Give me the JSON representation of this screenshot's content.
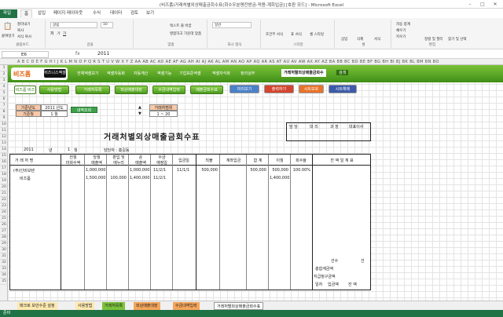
{
  "window": {
    "title": "(비즈폼)거래처별외상매출금회수표(회수우분명잔받금-적용-계회입금] [호환 모드] - Microsoft Excel"
  },
  "tabs": [
    "파일",
    "홈",
    "삽입",
    "페이지 레이아웃",
    "수식",
    "데이터",
    "검토",
    "보기"
  ],
  "ribbon": {
    "paste": "붙여넣기",
    "cut": "잘라내기",
    "copy": "복사",
    "format_copy": "서식 복사",
    "clipboard": "클립보드",
    "font_name": "굴림",
    "font_size": "10",
    "font_group": "글꼴",
    "align_group": "맞춤",
    "number_group": "표시 형식",
    "style_group": "스타일",
    "cells_group": "셀",
    "insert": "삽입",
    "delete": "삭제",
    "format": "서식",
    "edit_group": "편집",
    "autosum": "자동 합계",
    "fill": "채우기",
    "clear": "지우기",
    "sort": "정렬 및 필터",
    "find": "찾기 및 선택",
    "wrap": "텍스트 줄 바꿈",
    "merge": "병합하고 가운데 맞춤",
    "general": "일반",
    "cond": "조건부 서식",
    "table": "표 서식",
    "cellstyle": "셀 스타일"
  },
  "formula": {
    "cell": "E6",
    "value": "2011"
  },
  "columns_header": "A B C D E F G H I J K L M N O P Q R S T U V W X Y Z AA AB AC AD AE AF AG AH AI AJ AK AL AM AN AO AP AQ AR AS AT AU AV AW AX AY AZ BA BB BC BD BE BF BG BH BI BJ BK BL BM BN BO",
  "rows": [
    "1",
    "2",
    "3",
    "4",
    "5",
    "6",
    "7",
    "8",
    "9",
    "10",
    "11",
    "12",
    "13",
    "14",
    "15",
    "16",
    "17",
    "18",
    "19",
    "20",
    "21",
    "22",
    "23",
    "24",
    "25",
    "26",
    "27",
    "28",
    "29",
    "30",
    "31",
    "32",
    "33",
    "34",
    "35"
  ],
  "banner": {
    "logo": "비즈폼",
    "logo_sub": "비즈니스엑셀",
    "nav": [
      "전체엑셀보기",
      "엑셀자동화",
      "자동계산",
      "엑셀기능",
      "기업표준엑셀",
      "엑셀자식화",
      "정리실무"
    ],
    "selected": "거래처별외상매출금회수",
    "search": "검색"
  },
  "buttons": {
    "b1": "비즈폼 비즈",
    "b2": "사용방법",
    "b3": "거래처목록",
    "b4": "외상매출대장",
    "b5": "수금내역입력",
    "b6": "매출금회수표",
    "print_preview": "미리보기",
    "print": "출력하기",
    "sheet_protect": "시트보호",
    "sheet_unprotect": "시트해제",
    "search_detail": "내역조회"
  },
  "filter": {
    "year_label": "기준년도",
    "year": "2011 년도",
    "month_label": "기준월",
    "month": "1 월",
    "range_label": "거래처범위",
    "range": "1 ~ 20"
  },
  "doc": {
    "title": "거래처별외상매출금회수표",
    "year": "2011",
    "year_unit": "년",
    "month": "1",
    "month_unit": "월",
    "manager": "담당자 : 홍길동",
    "approval": [
      "담 당",
      "대 리",
      "과 장",
      "대표이사"
    ],
    "headers": [
      "거 래 처 명",
      "전월\n미회수액",
      "당월\n매출액",
      "판입 및\n에누리",
      "순\n매출액",
      "수금\n예정일",
      "입금일",
      "직불",
      "계좌입금",
      "합 계",
      "이월",
      "회수율",
      "잔 액 일 계 표"
    ],
    "rows": [
      [
        "(주)인비모텐",
        "",
        "1,000,000",
        "",
        "1,000,000",
        "11/2/1",
        "11/1/1",
        "500,000",
        "",
        "500,000",
        "500,000",
        "100.00%"
      ],
      [
        "비즈폼",
        "",
        "1,500,000",
        "100,000",
        "1,400,000",
        "11/2/1",
        "",
        "",
        "",
        "",
        "1,400,000",
        ""
      ]
    ],
    "summary": {
      "count": "건수",
      "count_unit": "건",
      "total_label": "총합계금액",
      "paid_label": "지급청구금액",
      "date": "일자",
      "deposit": "입금액",
      "balance": "잔 액"
    }
  },
  "sheettabs": [
    "매크로 보안수준 설정",
    "사용방법",
    "거래처목록",
    "외상매출대장",
    "수금내역입력",
    "거래처별외상매출금회수표"
  ],
  "status": "준비"
}
